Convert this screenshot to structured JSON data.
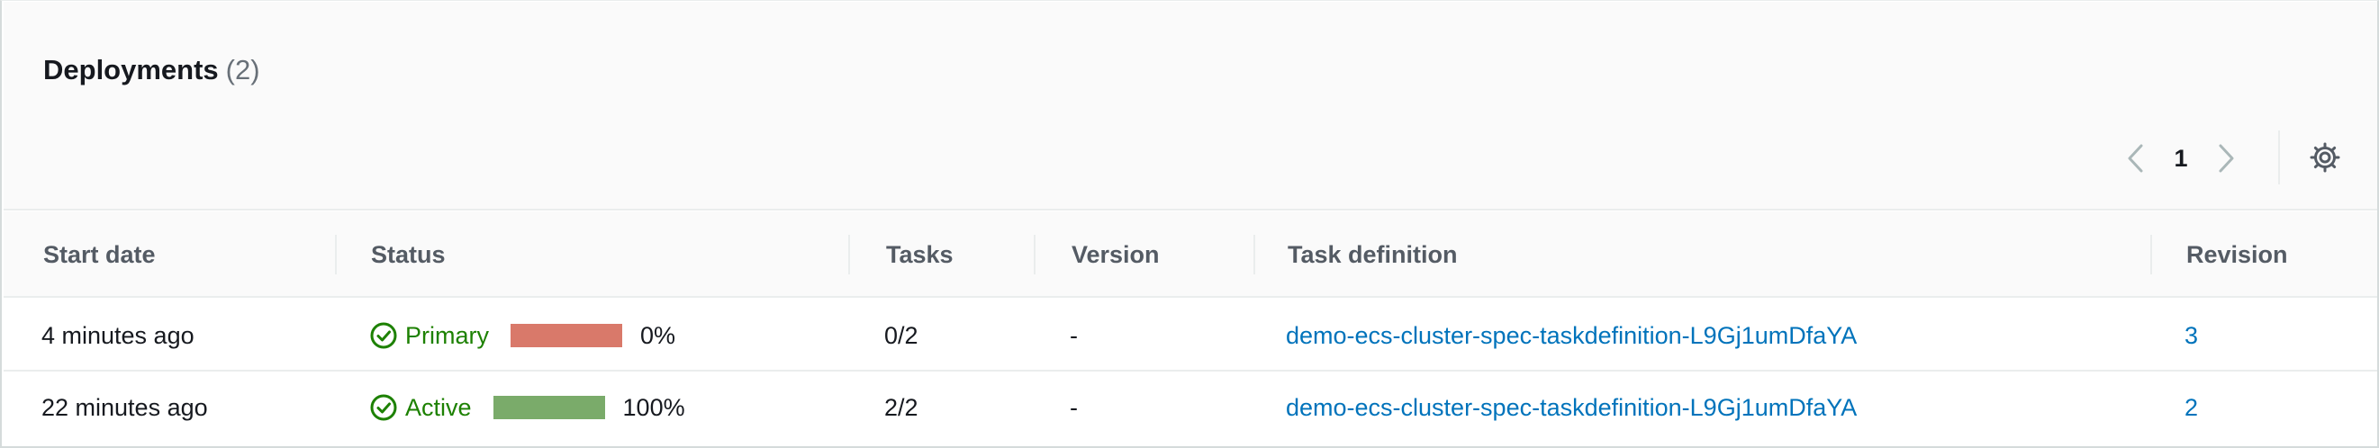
{
  "header": {
    "title": "Deployments",
    "count": "(2)"
  },
  "pagination": {
    "current_page": "1",
    "prev_icon": "chevron-left-icon",
    "next_icon": "chevron-right-icon",
    "settings_icon": "gear-icon"
  },
  "table": {
    "columns": [
      "Start date",
      "Status",
      "Tasks",
      "Version",
      "Task definition",
      "Revision"
    ],
    "rows": [
      {
        "start_date": "4 minutes ago",
        "status": "Primary",
        "status_icon": "check-circle-icon",
        "progress_percent_label": "0%",
        "progress_fraction": 0,
        "progress_bar_color": "#d9796a",
        "tasks": "0/2",
        "version": "-",
        "task_definition": "demo-ecs-cluster-spec-taskdefinition-L9Gj1umDfaYA",
        "revision": "3"
      },
      {
        "start_date": "22 minutes ago",
        "status": "Active",
        "status_icon": "check-circle-icon",
        "progress_percent_label": "100%",
        "progress_fraction": 1,
        "progress_bar_color": "#7aab6a",
        "tasks": "2/2",
        "version": "-",
        "task_definition": "demo-ecs-cluster-spec-taskdefinition-L9Gj1umDfaYA",
        "revision": "2"
      }
    ]
  },
  "colors": {
    "status_success": "#1d8102",
    "link": "#0073bb"
  }
}
